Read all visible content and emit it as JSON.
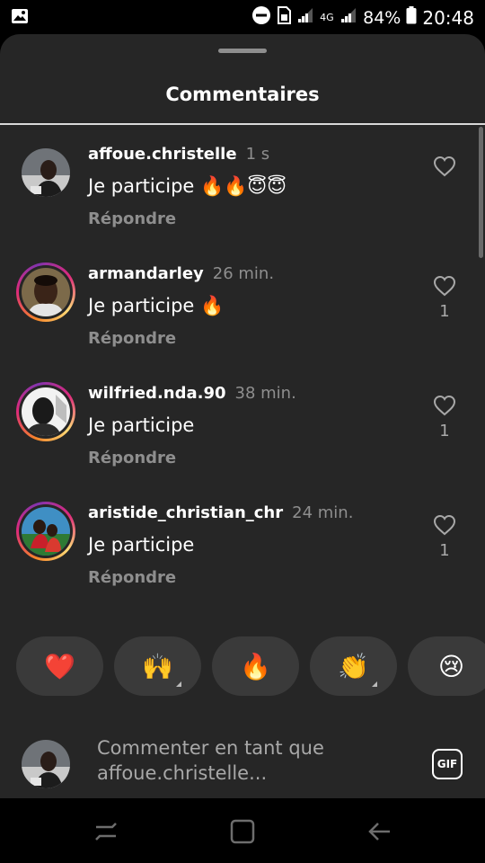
{
  "status_bar": {
    "network": "4G",
    "battery": "84%",
    "time": "20:48",
    "icons": [
      "image-icon",
      "dnd-icon",
      "sim-icon",
      "signal-icon",
      "battery-icon"
    ]
  },
  "sheet": {
    "title": "Commentaires"
  },
  "comments": [
    {
      "username": "affoue.christelle",
      "time": "1 s",
      "text": "Je participe 🔥🔥😇😇",
      "reply": "Répondre",
      "likes": ""
    },
    {
      "username": "armandarley",
      "time": "26 min.",
      "text": "Je participe 🔥",
      "reply": "Répondre",
      "likes": "1"
    },
    {
      "username": "wilfried.nda.90",
      "time": "38 min.",
      "text": "Je participe",
      "reply": "Répondre",
      "likes": "1"
    },
    {
      "username": "aristide_christian_chr",
      "time": "24 min.",
      "text": "Je participe",
      "reply": "Répondre",
      "likes": "1"
    }
  ],
  "reactions": [
    "❤️",
    "🙌",
    "🔥",
    "👏",
    "😢"
  ],
  "composer": {
    "placeholder": "Commenter en tant que affoue.christelle...",
    "gif_label": "GIF"
  },
  "colors": {
    "sheet_bg": "#262626",
    "secondary_text": "#8e8e8e",
    "reaction_bg": "#3a3a3a"
  }
}
